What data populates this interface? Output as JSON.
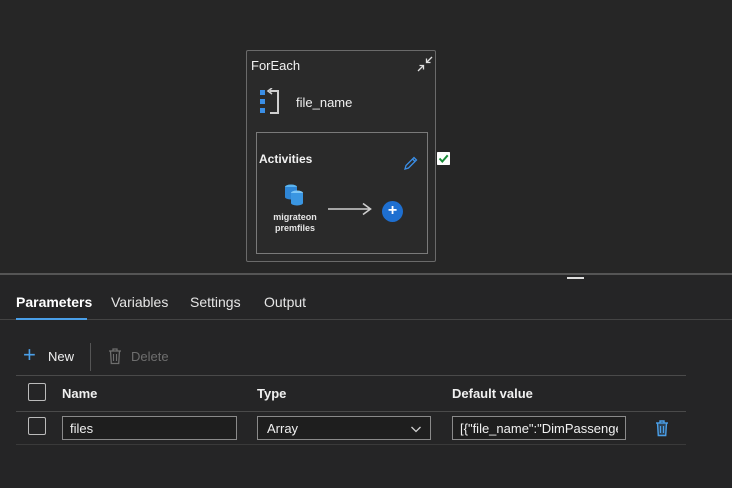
{
  "foreach": {
    "title": "ForEach",
    "items_label": "file_name",
    "activities_title": "Activities",
    "activity_name": "migrateon premfiles",
    "add_symbol": "+",
    "icons": {
      "collapse": "collapse-icon",
      "foreach_type": "foreach-icon",
      "edit": "pencil-icon",
      "activity": "database-icon",
      "arrow": "arrow-right-icon",
      "check": "checkbox-checked-icon"
    },
    "check_state": true
  },
  "tabs": [
    {
      "label": "Parameters",
      "active": true
    },
    {
      "label": "Variables",
      "active": false
    },
    {
      "label": "Settings",
      "active": false
    },
    {
      "label": "Output",
      "active": false
    }
  ],
  "toolbar": {
    "new_symbol": "+",
    "new_label": "New",
    "delete_label": "Delete",
    "delete_enabled": false
  },
  "table": {
    "columns": [
      "Name",
      "Type",
      "Default value"
    ],
    "rows": [
      {
        "checked": false,
        "name": "files",
        "type": "Array",
        "default_value": "[{\"file_name\":\"DimPassenger"
      }
    ]
  },
  "colors": {
    "accent": "#4a9fe8",
    "add_button": "#1e6fd0",
    "background": "#242424",
    "panel": "#252526"
  }
}
